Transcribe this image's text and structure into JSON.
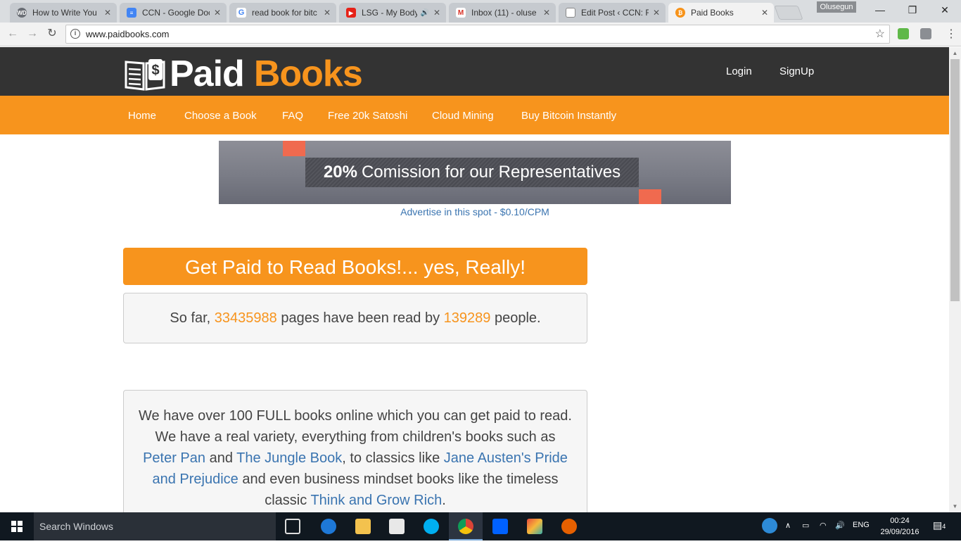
{
  "browser": {
    "tabs": [
      {
        "title": "How to Write You",
        "favicon": "wd-icon",
        "color": "#6a6e75"
      },
      {
        "title": "CCN - Google Doc",
        "favicon": "google-docs-icon",
        "color": "#4285f4"
      },
      {
        "title": "read book for bitc",
        "favicon": "google-icon",
        "color": "#ffffff"
      },
      {
        "title": "LSG - My Body",
        "favicon": "youtube-icon",
        "color": "#e62117"
      },
      {
        "title": "Inbox (11) - oluse",
        "favicon": "gmail-icon",
        "color": "#ffffff"
      },
      {
        "title": "Edit Post ‹ CCN: F",
        "favicon": "page-icon",
        "color": "#ffffff"
      },
      {
        "title": "Paid Books",
        "favicon": "bitcoin-icon",
        "color": "#f7931a"
      }
    ],
    "profile_name": "Olusegun",
    "url": "www.paidbooks.com"
  },
  "site": {
    "logo_word1": "Paid",
    "logo_word2": "Books",
    "header_links": {
      "login": "Login",
      "signup": "SignUp"
    },
    "nav": [
      "Home",
      "Choose a Book",
      "FAQ",
      "Free 20k Satoshi",
      "Cloud Mining",
      "Buy Bitcoin Instantly"
    ],
    "banner": {
      "bold": "20%",
      "text": "Comission for our Representatives"
    },
    "ad_link": "Advertise in this spot - $0.10/CPM",
    "hero_title": "Get Paid to Read Books!... yes, Really!",
    "stats": {
      "prefix": "So far,",
      "pages": "33435988",
      "middle": "pages have been read by",
      "people": "139289",
      "suffix": "people."
    },
    "intro": {
      "t1": "We have over 100 FULL books online which you can get paid to read. We have a real variety, everything from children's books such as",
      "l1": "Peter Pan",
      "t2": "and",
      "l2": "The Jungle Book",
      "t3": ", to classics like",
      "l3": "Jane Austen's Pride and Prejudice",
      "t4": "and even business mindset books like the timeless classic",
      "l4": "Think and Grow Rich",
      "t5": "."
    },
    "colors": {
      "accent": "#f7941d",
      "header_bg": "#333333",
      "link": "#3a74b0"
    }
  },
  "taskbar": {
    "search_placeholder": "Search Windows",
    "language": "ENG",
    "time": "00:24",
    "date": "29/09/2016",
    "notification_count": "4"
  }
}
